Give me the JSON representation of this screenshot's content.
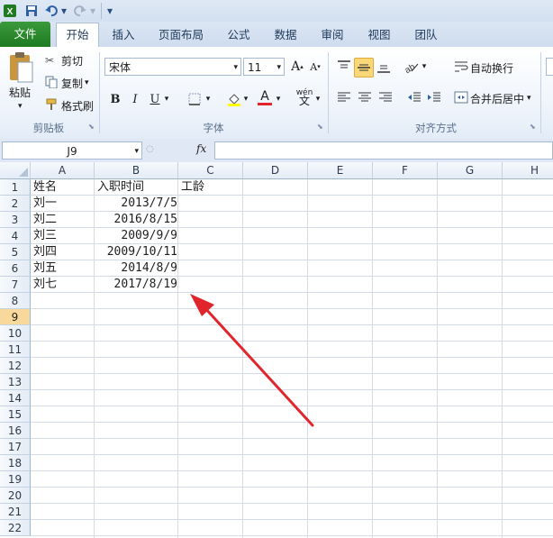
{
  "qat": {
    "more": "▾"
  },
  "tabs": [
    {
      "label": "文件",
      "kind": "file"
    },
    {
      "label": "开始",
      "kind": "active"
    },
    {
      "label": "插入",
      "kind": ""
    },
    {
      "label": "页面布局",
      "kind": ""
    },
    {
      "label": "公式",
      "kind": ""
    },
    {
      "label": "数据",
      "kind": ""
    },
    {
      "label": "审阅",
      "kind": ""
    },
    {
      "label": "视图",
      "kind": ""
    },
    {
      "label": "团队",
      "kind": ""
    }
  ],
  "clipboard": {
    "paste": "粘贴",
    "cut": "剪切",
    "copy": "复制",
    "painter": "格式刷",
    "group": "剪贴板"
  },
  "font": {
    "name": "宋体",
    "size": "11",
    "bold": "B",
    "italic": "I",
    "underline": "U",
    "group": "字体",
    "grow": "A",
    "shrink": "A",
    "fontcolor": "A",
    "phonetic": "wén"
  },
  "align": {
    "wrap": "自动换行",
    "merge": "合并后居中",
    "group": "对齐方式"
  },
  "formula": {
    "namebox": "J9",
    "fx": "fx",
    "value": ""
  },
  "columns": [
    "A",
    "B",
    "C",
    "D",
    "E",
    "F",
    "G",
    "H"
  ],
  "rows": [
    "1",
    "2",
    "3",
    "4",
    "5",
    "6",
    "7",
    "8",
    "9",
    "10",
    "11",
    "12",
    "13",
    "14",
    "15",
    "16",
    "17",
    "18",
    "19",
    "20",
    "21",
    "22"
  ],
  "selected_row": "9",
  "sheet": {
    "headers": {
      "a": "姓名",
      "b": "入职时间",
      "c": "工龄"
    },
    "data": [
      {
        "name": "刘一",
        "date": "2013/7/5"
      },
      {
        "name": "刘二",
        "date": "2016/8/15"
      },
      {
        "name": "刘三",
        "date": "2009/9/9"
      },
      {
        "name": "刘四",
        "date": "2009/10/11"
      },
      {
        "name": "刘五",
        "date": "2014/8/9"
      },
      {
        "name": "刘七",
        "date": "2017/8/19"
      }
    ]
  },
  "colors": {
    "file_tab": "#2a8a2c",
    "arrow": "#e0262c",
    "selected_row": "#f9d99b"
  }
}
